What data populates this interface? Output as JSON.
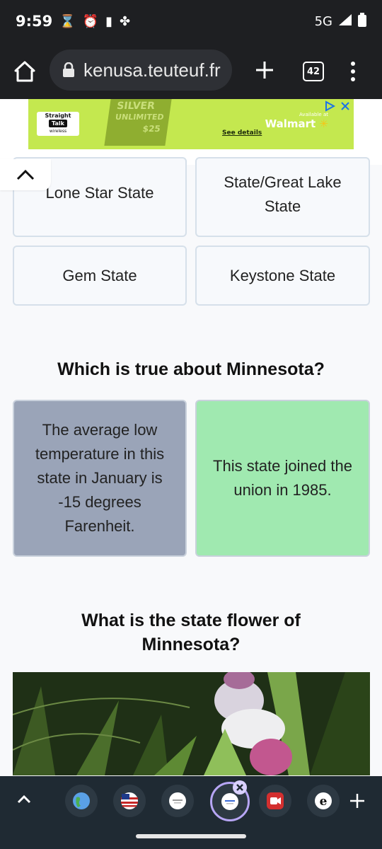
{
  "status_bar": {
    "time": "9:59",
    "network": "5G",
    "icons": [
      "hourglass-icon",
      "alarm-icon",
      "battery-icon",
      "pinwheel-icon",
      "signal-icon",
      "battery-icon"
    ]
  },
  "browser": {
    "url": "kenusa.teuteuf.fr",
    "tab_count": "42"
  },
  "ad": {
    "brand_line1": "Straight",
    "brand_line2": "Talk",
    "brand_line3": "wireless",
    "card_line1": "SILVER",
    "card_line2": "UNLIMITED",
    "card_price": "$25",
    "link": "See details",
    "available_at": "Available at",
    "store": "Walmart",
    "accent_color": "#c4e84f"
  },
  "quiz": {
    "prev_options": [
      "Lone Star State",
      "State/Great Lake State",
      "Gem State",
      "Keystone State"
    ],
    "question2": "Which is true about Minnesota?",
    "q2_options": [
      {
        "text": "The average low temperature in this state in January is -15 degrees Farenheit.",
        "color": "#9aa4b8"
      },
      {
        "text": "This state joined the union in 1985.",
        "color": "#a0e9b0"
      }
    ],
    "question3": "What is the state flower of Minnesota?"
  },
  "tab_strip": {
    "tabs": [
      "globe-tab",
      "us-flag-tab",
      "page-tab",
      "active-page-tab",
      "video-tab",
      "e-tab"
    ]
  }
}
